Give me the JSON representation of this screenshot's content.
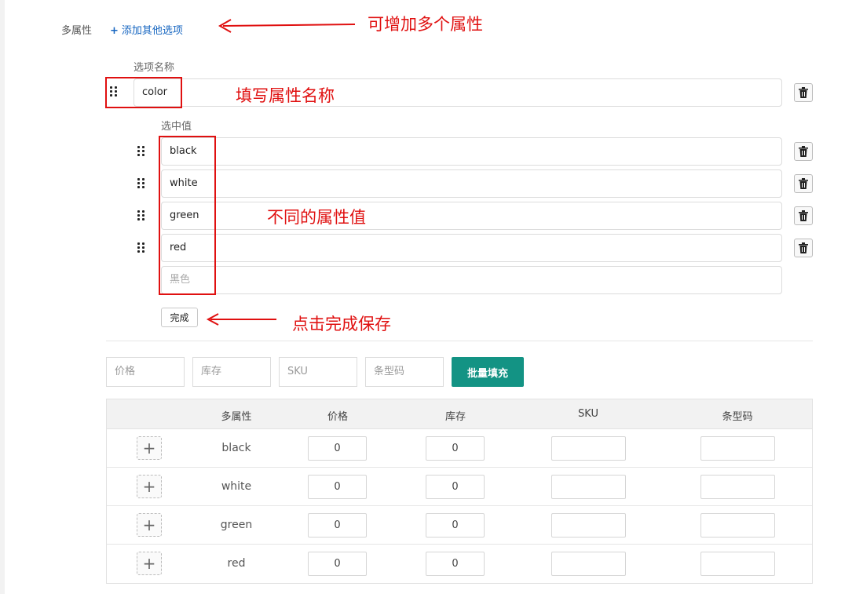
{
  "header": {
    "label": "多属性",
    "add_link": "添加其他选项"
  },
  "annotations": {
    "add_multi": "可增加多个属性",
    "fill_name": "填写属性名称",
    "diff_values": "不同的属性值",
    "click_save": "点击完成保存"
  },
  "option": {
    "name_label": "选项名称",
    "name_value": "color",
    "values_label": "选中值",
    "values": [
      "black",
      "white",
      "green",
      "red"
    ],
    "new_value_placeholder": "黑色",
    "done_label": "完成"
  },
  "bulk": {
    "price_placeholder": "价格",
    "stock_placeholder": "库存",
    "sku_placeholder": "SKU",
    "barcode_placeholder": "条型码",
    "fill_button": "批量填充"
  },
  "table": {
    "headers": [
      "多属性",
      "价格",
      "库存",
      "SKU",
      "条型码"
    ],
    "rows": [
      {
        "attr": "black",
        "price": "0",
        "stock": "0",
        "sku": "",
        "barcode": ""
      },
      {
        "attr": "white",
        "price": "0",
        "stock": "0",
        "sku": "",
        "barcode": ""
      },
      {
        "attr": "green",
        "price": "0",
        "stock": "0",
        "sku": "",
        "barcode": ""
      },
      {
        "attr": "red",
        "price": "0",
        "stock": "0",
        "sku": "",
        "barcode": ""
      }
    ]
  },
  "colors": {
    "annotation": "#e01010",
    "link": "#1565c0",
    "primary_button": "#139384"
  },
  "icons": {
    "drag": "drag-handle-icon",
    "delete": "trash-icon",
    "add": "plus-icon",
    "arrow": "arrow-left-icon"
  }
}
